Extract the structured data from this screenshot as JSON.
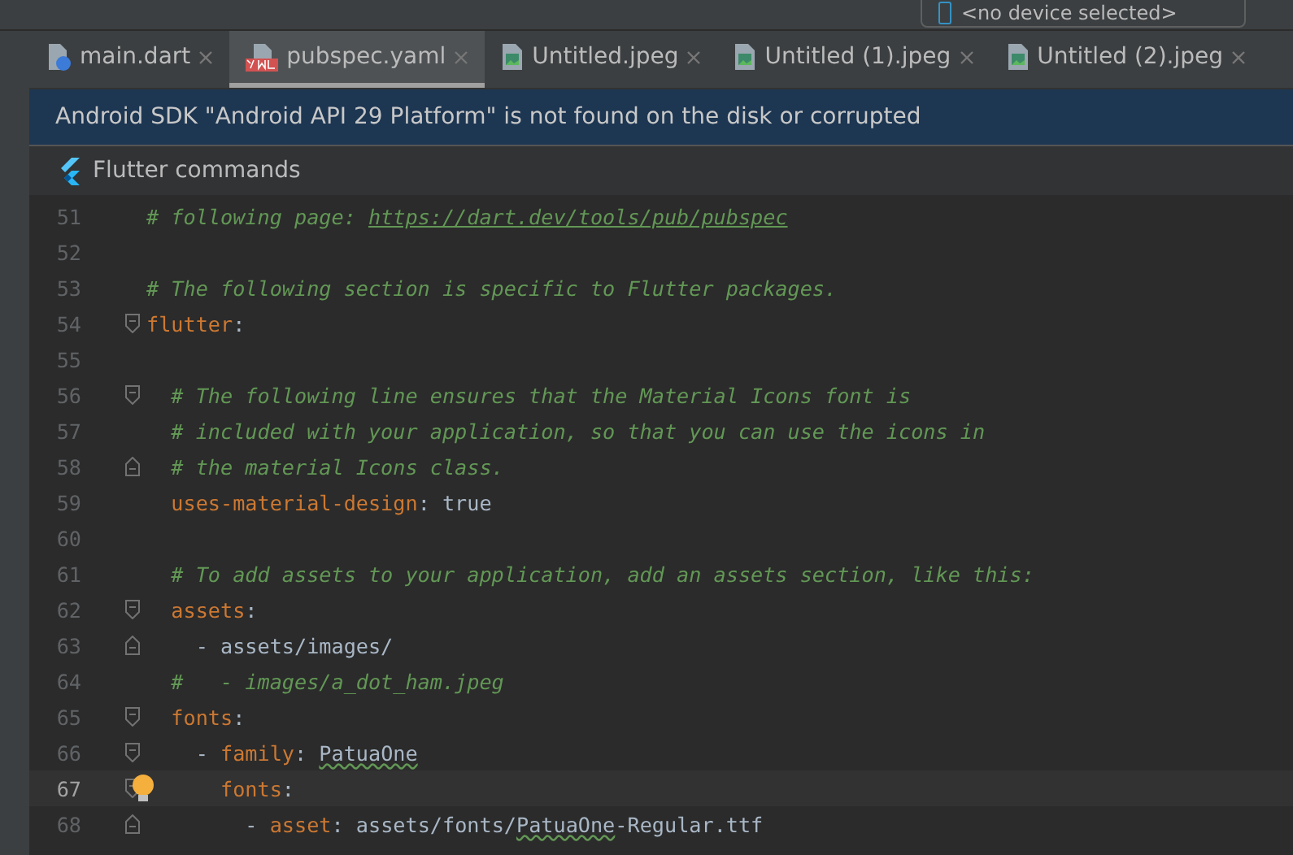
{
  "device_selector": {
    "label": "<no device selected>"
  },
  "tabs": [
    {
      "label": "main.dart",
      "kind": "dart",
      "selected": false
    },
    {
      "label": "pubspec.yaml",
      "kind": "yaml",
      "selected": true
    },
    {
      "label": "Untitled.jpeg",
      "kind": "image",
      "selected": false
    },
    {
      "label": "Untitled (1).jpeg",
      "kind": "image",
      "selected": false
    },
    {
      "label": "Untitled (2).jpeg",
      "kind": "image",
      "selected": false
    }
  ],
  "banner": {
    "message": "Android SDK \"Android API 29 Platform\" is not found on the disk or corrupted"
  },
  "flutter_commands": {
    "label": "Flutter commands"
  },
  "editor": {
    "lines": [
      {
        "number": "51",
        "current": false,
        "tokens": [
          {
            "kind": "comment",
            "text": "# following page: "
          },
          {
            "kind": "url",
            "text": "https://dart.dev/tools/pub/pubspec"
          }
        ]
      },
      {
        "number": "52",
        "current": false
      },
      {
        "number": "53",
        "current": false,
        "tokens": [
          {
            "kind": "comment",
            "text": "# The following section is specific to Flutter packages."
          }
        ]
      },
      {
        "number": "54",
        "fold_open": true,
        "current": false,
        "tokens": [
          {
            "kind": "key",
            "text": "flutter"
          },
          {
            "kind": "plain",
            "text": ":"
          }
        ]
      },
      {
        "number": "55",
        "current": false
      },
      {
        "number": "56",
        "fold_open": true,
        "current": false,
        "tokens": [
          {
            "kind": "comment",
            "text": "  # The following line ensures that the Material Icons font is"
          }
        ]
      },
      {
        "number": "57",
        "current": false,
        "tokens": [
          {
            "kind": "comment",
            "text": "  # included with your application, so that you can use the icons in"
          }
        ]
      },
      {
        "number": "58",
        "fold_close": true,
        "current": false,
        "tokens": [
          {
            "kind": "comment",
            "text": "  # the material Icons class."
          }
        ]
      },
      {
        "number": "59",
        "current": false,
        "tokens": [
          {
            "kind": "key",
            "text": "  uses-material-design"
          },
          {
            "kind": "plain",
            "text": ": true"
          }
        ]
      },
      {
        "number": "60",
        "current": false
      },
      {
        "number": "61",
        "current": false,
        "tokens": [
          {
            "kind": "comment",
            "text": "  # To add assets to your application, add an assets section, like this:"
          }
        ]
      },
      {
        "number": "62",
        "fold_open": true,
        "current": false,
        "tokens": [
          {
            "kind": "key",
            "text": "  assets"
          },
          {
            "kind": "plain",
            "text": ":"
          }
        ]
      },
      {
        "number": "63",
        "fold_close": true,
        "current": false,
        "tokens": [
          {
            "kind": "plain",
            "text": "    - assets/images/"
          }
        ]
      },
      {
        "number": "64",
        "current": false,
        "tokens": [
          {
            "kind": "comment",
            "text": "  #   - images/a_dot_ham.jpeg"
          }
        ]
      },
      {
        "number": "65",
        "fold_open": true,
        "current": false,
        "tokens": [
          {
            "kind": "key",
            "text": "  fonts"
          },
          {
            "kind": "plain",
            "text": ":"
          }
        ]
      },
      {
        "number": "66",
        "fold_open": true,
        "current": false,
        "tokens": [
          {
            "kind": "plain",
            "text": "    - "
          },
          {
            "kind": "key",
            "text": "family"
          },
          {
            "kind": "plain",
            "text": ": "
          },
          {
            "kind": "typo",
            "text": "PatuaOne"
          }
        ]
      },
      {
        "number": "67",
        "fold_open": true,
        "current": true,
        "tokens": [
          {
            "kind": "key",
            "text": "      fonts"
          },
          {
            "kind": "plain",
            "text": ":"
          }
        ]
      },
      {
        "number": "68",
        "fold_close": true,
        "current": false,
        "tokens": [
          {
            "kind": "plain",
            "text": "        - "
          },
          {
            "kind": "key",
            "text": "asset"
          },
          {
            "kind": "plain",
            "text": ": assets/fonts/"
          },
          {
            "kind": "typo",
            "text": "PatuaOne"
          },
          {
            "kind": "plain",
            "text": "-Regular.ttf"
          }
        ]
      }
    ]
  }
}
